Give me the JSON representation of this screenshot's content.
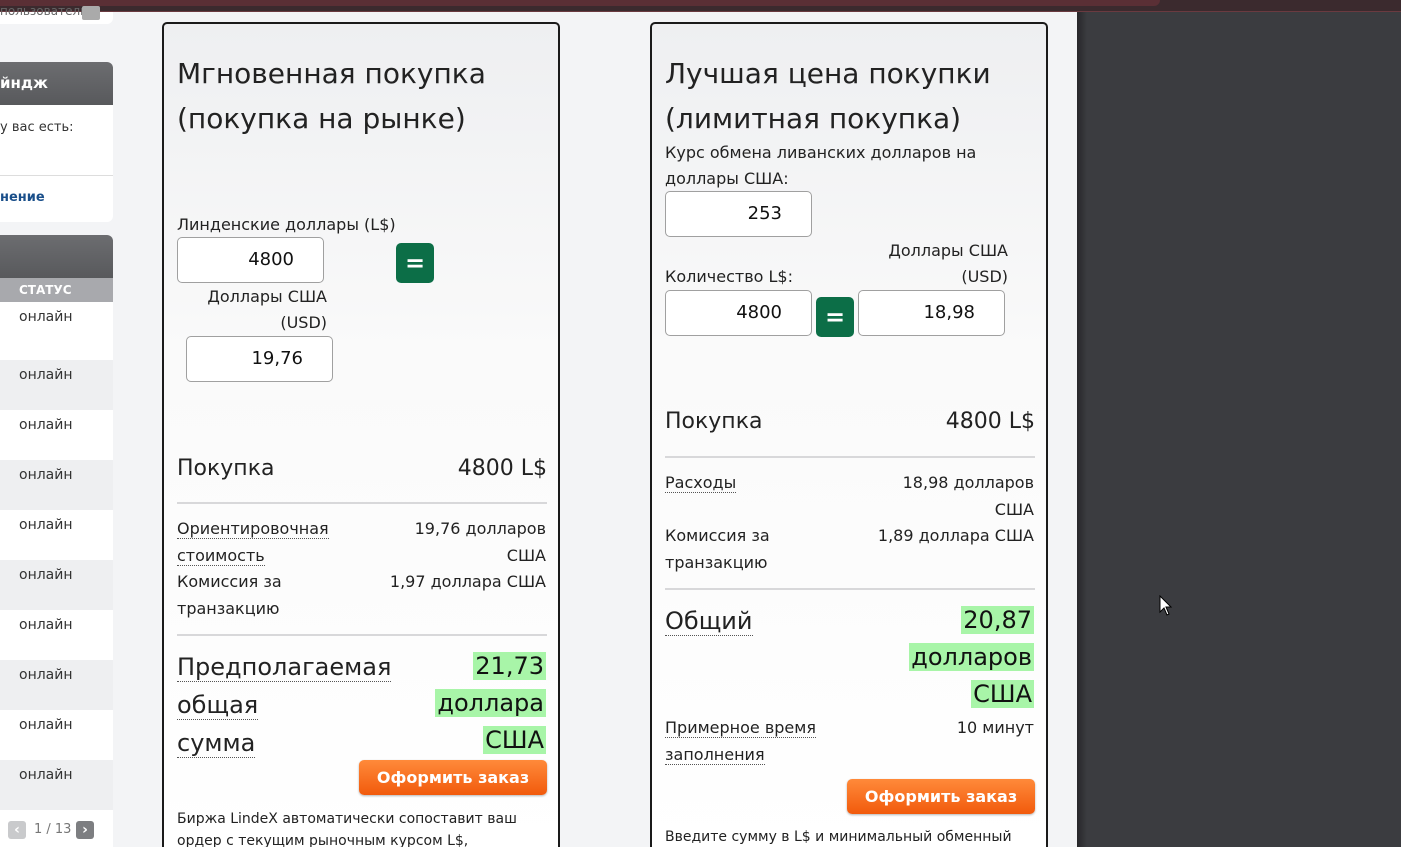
{
  "sidebar": {
    "top_item_text": "пользователь",
    "panel1": {
      "title": "йндж",
      "have_text": "у вас есть:",
      "link_text": "нение"
    },
    "status_column_header": "СТАТУС",
    "statuses": [
      "онлайн",
      "онлайн",
      "онлайн",
      "онлайн",
      "онлайн",
      "онлайн",
      "онлайн",
      "онлайн",
      "онлайн",
      "онлайн"
    ],
    "pager": {
      "text": "1 / 13",
      "prev": "‹",
      "next": "›"
    }
  },
  "market": {
    "title_line1": "Мгновенная покупка",
    "title_line2": "(покупка на рынке)",
    "lindens_label": "Линденские доллары (L$)",
    "lindens_value": "4800",
    "eq_label": "=",
    "usd_label_line1": "Доллары США",
    "usd_label_line2": "(USD)",
    "usd_value": "19,76",
    "purchase_label": "Покупка",
    "purchase_value": "4800 L$",
    "approx_cost_label_1": "Ориентировочная",
    "approx_cost_label_2": "стоимость",
    "approx_cost_value_1": "19,76 долларов",
    "approx_cost_value_2": "США",
    "fee_label_1": "Комиссия за",
    "fee_label_2": "транзакцию",
    "fee_value": "1,97 доллара США",
    "total_label_1": "Предполагаемая",
    "total_label_2": "общая",
    "total_label_3": "сумма",
    "total_value_1": "21,73",
    "total_value_2": "доллара",
    "total_value_3": "США",
    "order_button": "Оформить заказ",
    "footer_line1": "Биржа LindeX автоматически сопоставит ваш",
    "footer_line2": "ордер с текущим рыночным курсом L$,"
  },
  "limit": {
    "title_line1": "Лучшая цена покупки",
    "title_line2": "(лимитная покупка)",
    "rate_label_line1": "Курс обмена ливанских долларов на",
    "rate_label_line2": "доллары США:",
    "rate_value": "253",
    "usd_label_line1": "Доллары США",
    "usd_label_line2": "(USD)",
    "qty_label": "Количество L$:",
    "qty_value": "4800",
    "eq_label": "=",
    "usd_value": "18,98",
    "purchase_label": "Покупка",
    "purchase_value": "4800 L$",
    "expenses_label": "Расходы",
    "expenses_value_1": "18,98 долларов",
    "expenses_value_2": "США",
    "fee_label_1": "Комиссия за",
    "fee_label_2": "транзакцию",
    "fee_value": "1,89 доллара США",
    "total_label": "Общий",
    "total_value_1": "20,87",
    "total_value_2": "долларов",
    "total_value_3": "США",
    "fill_time_label_1": "Примерное время",
    "fill_time_label_2": "заполнения",
    "fill_time_value": "10 минут",
    "order_button": "Оформить заказ",
    "footer_line1": "Введите сумму в L$ и минимальный обменный"
  },
  "colors": {
    "eq_button": "#0c6e47",
    "order_button": "#f15a0c",
    "total_highlight": "#a8f5a8",
    "desktop_bg": "#3b3c40"
  }
}
